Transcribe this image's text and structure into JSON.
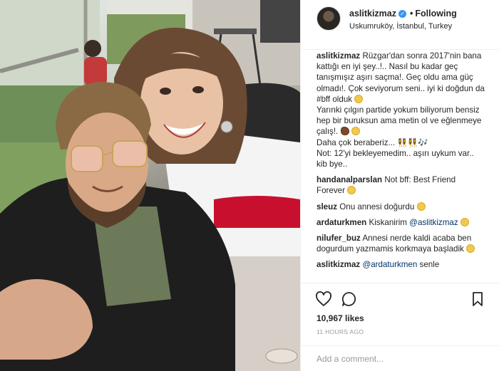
{
  "header": {
    "username": "aslitkizmaz",
    "follow_status": "Following",
    "location": "Uskumruköy, İstanbul, Turkey"
  },
  "caption": {
    "username": "aslitkizmaz",
    "line1": "Rüzgar'dan sonra 2017'nin bana kattığı en iyi şey..!.. Nasıl bu kadar geç tanışmışız aşırı saçma!. Geç oldu ama güç olmadı!. Çok seviyorum seni.. iyi ki doğdun da #bff olduk",
    "line2": "Yarınki çılgın partide yokum biliyorum bensiz hep bir buruksun ama metin ol ve eğlenmeye çalış!.",
    "line3": "Daha çok beraberiz... 👯‍♀️👯‍♀️🎶",
    "line4": "Not: 12'yi bekleyemedim.. aşırı uykum var.. kib bye.."
  },
  "comments": [
    {
      "username": "handanalparslan",
      "text": "Not bff: Best Friend Forever"
    },
    {
      "username": "sleuz",
      "text": "Onu annesi doğurdu"
    },
    {
      "username": "ardaturkmen",
      "text": "Kiskanirim",
      "mention": "@aslitkizmaz"
    },
    {
      "username": "nilufer_buz",
      "text": "Annesi nerde kaldi acaba ben dogurdum yazmamis korkmaya başladik"
    },
    {
      "username": "aslitkizmaz",
      "mention": "@ardaturkmen",
      "text": "senle"
    }
  ],
  "post": {
    "likes": "10,967 likes",
    "time": "11 HOURS AGO"
  },
  "comment_input": {
    "placeholder": "Add a comment..."
  },
  "icons": {
    "like": "heart-icon",
    "comment": "comment-icon",
    "save": "bookmark-icon",
    "verified": "verified-badge-icon"
  },
  "colors": {
    "verified": "#3897f0",
    "mention": "#003569",
    "meta": "#999999"
  }
}
